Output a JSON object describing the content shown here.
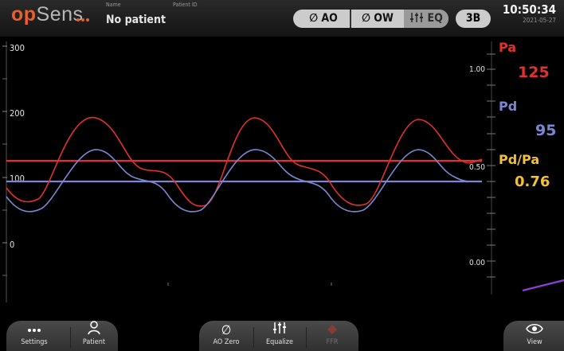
{
  "header": {
    "logo_op": "op",
    "logo_sens": "Sens",
    "name_caption": "Name",
    "patient_name": "No patient",
    "patient_id_caption": "Patient ID",
    "status": {
      "ao_label": "∅ AO",
      "ow_label": "∅ OW",
      "eq_label": "EQ",
      "badge": "3B"
    },
    "time": "10:50:34",
    "date": "2021-05-27"
  },
  "left_axis": {
    "ticks": [
      "300",
      "200",
      "100",
      "0"
    ]
  },
  "ratio_axis": {
    "ticks": [
      "1.00",
      "0.50",
      "0.00"
    ]
  },
  "metrics": {
    "pa_label": "Pa",
    "pa_value": "125",
    "pd_label": "Pd",
    "pd_value": "95",
    "ratio_label": "Pd/Pa",
    "ratio_value": "0.76"
  },
  "colors": {
    "pa": "#e0312f",
    "pd": "#7c86d2",
    "ratio": "#f3c03b",
    "trend": "#8a3fd1",
    "brand": "#e8612c"
  },
  "toolbar": {
    "settings_label": "Settings",
    "patient_label": "Patient",
    "ao_zero_label": "AO Zero",
    "equalize_label": "Equalize",
    "ffr_label": "FFR",
    "view_label": "View"
  }
}
